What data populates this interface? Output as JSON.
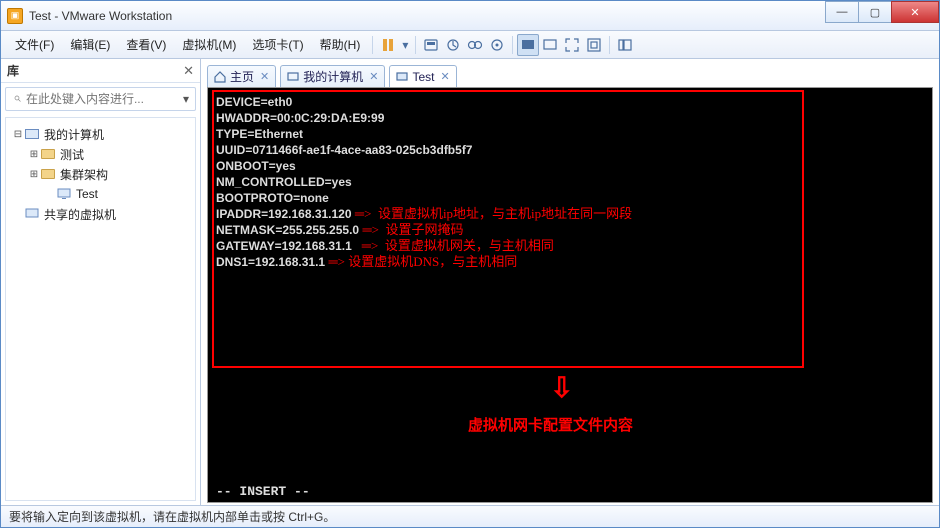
{
  "window": {
    "title": "Test - VMware Workstation"
  },
  "menu": {
    "file": "文件(F)",
    "edit": "编辑(E)",
    "view": "查看(V)",
    "vm": "虚拟机(M)",
    "tabs": "选项卡(T)",
    "help": "帮助(H)"
  },
  "sidebar": {
    "title": "库",
    "search_placeholder": "在此处键入内容进行...",
    "tree": {
      "root": "我的计算机",
      "items": [
        "测试",
        "集群架构",
        "Test"
      ],
      "shared": "共享的虚拟机"
    }
  },
  "tabs": {
    "home": "主页",
    "mycomputer": "我的计算机",
    "test": "Test"
  },
  "config_lines": [
    "DEVICE=eth0",
    "HWADDR=00:0C:29:DA:E9:99",
    "TYPE=Ethernet",
    "UUID=0711466f-ae1f-4ace-aa83-025cb3dfb5f7",
    "ONBOOT=yes",
    "NM_CONTROLLED=yes",
    "BOOTPROTO=none",
    "IPADDR=192.168.31.120",
    "NETMASK=255.255.255.0",
    "GATEWAY=192.168.31.1",
    "DNS1=192.168.31.1"
  ],
  "annotations": {
    "ipaddr": "设置虚拟机ip地址，与主机ip地址在同一网段",
    "netmask": "设置子网掩码",
    "gateway": "设置虚拟机网关，与主机相同",
    "dns": "设置虚拟机DNS，与主机相同",
    "summary": "虚拟机网卡配置文件内容"
  },
  "vim_mode": "-- INSERT --",
  "statusbar": "要将输入定向到该虚拟机，请在虚拟机内部单击或按 Ctrl+G。"
}
